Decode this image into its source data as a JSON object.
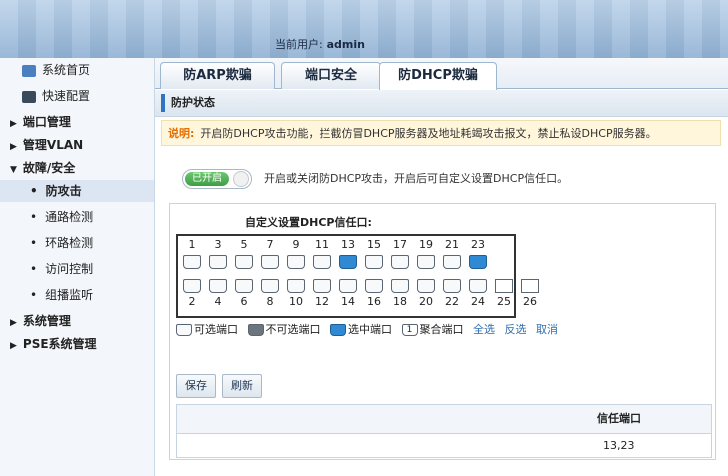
{
  "header": {
    "user_label": "当前用户:",
    "user_name": "admin"
  },
  "sidebar": {
    "items": [
      {
        "label": "系统首页"
      },
      {
        "label": "快速配置"
      },
      {
        "label": "端口管理"
      },
      {
        "label": "管理VLAN"
      },
      {
        "label": "故障/安全"
      },
      {
        "label": "防攻击"
      },
      {
        "label": "通路检测"
      },
      {
        "label": "环路检测"
      },
      {
        "label": "访问控制"
      },
      {
        "label": "组播监听"
      },
      {
        "label": "系统管理"
      },
      {
        "label": "PSE系统管理"
      }
    ]
  },
  "tabs": [
    {
      "label": "防ARP欺骗"
    },
    {
      "label": "端口安全"
    },
    {
      "label": "防DHCP欺骗"
    }
  ],
  "section_title": "防护状态",
  "note": {
    "label": "说明:",
    "text": "开启防DHCP攻击功能，拦截仿冒DHCP服务器及地址耗竭攻击报文，禁止私设DHCP服务器。"
  },
  "toggle": {
    "label": "已开启",
    "description": "开启或关闭防DHCP攻击，开启后可自定义设置DHCP信任口。"
  },
  "trust_port": {
    "title": "自定义设置DHCP信任口:",
    "odd_ports": [
      "1",
      "3",
      "5",
      "7",
      "9",
      "11",
      "13",
      "15",
      "17",
      "19",
      "21",
      "23"
    ],
    "even_ports": [
      "2",
      "4",
      "6",
      "8",
      "10",
      "12",
      "14",
      "16",
      "18",
      "20",
      "22",
      "24",
      "25",
      "26"
    ],
    "selected_ports": [
      "13",
      "23"
    ]
  },
  "legend": {
    "selectable": "可选端口",
    "unselectable": "不可选端口",
    "selected": "选中端口",
    "aggregate_num": "1",
    "aggregate": "聚合端口",
    "select_all": "全选",
    "invert": "反选",
    "cancel": "取消"
  },
  "buttons": {
    "save": "保存",
    "refresh": "刷新"
  },
  "table": {
    "header": "信任端口",
    "value": "13,23"
  }
}
